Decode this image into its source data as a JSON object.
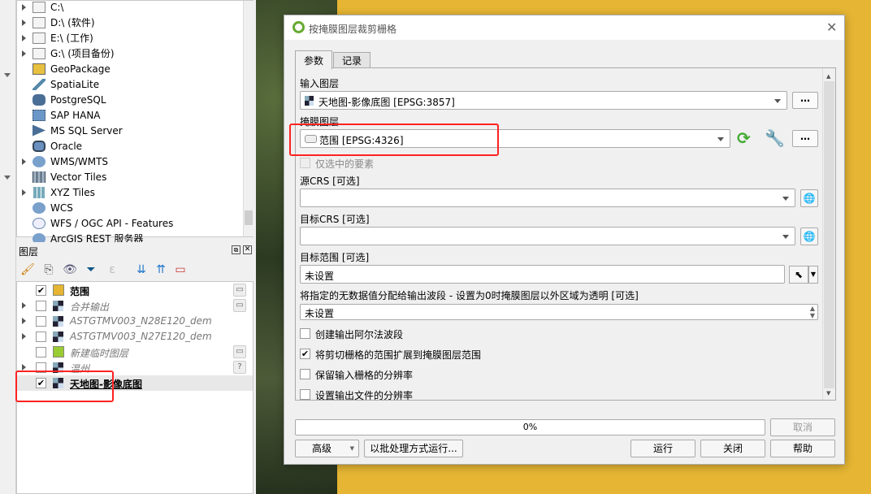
{
  "browser": {
    "items": [
      {
        "label": "C:\\",
        "icon": "folder-icon",
        "expand": true
      },
      {
        "label": "D:\\ (软件)",
        "icon": "folder-icon",
        "expand": true
      },
      {
        "label": "E:\\ (工作)",
        "icon": "folder-icon",
        "expand": true
      },
      {
        "label": "G:\\ (项目备份)",
        "icon": "folder-icon",
        "expand": true
      },
      {
        "label": "GeoPackage",
        "icon": "geopackage-icon",
        "expand": false
      },
      {
        "label": "SpatiaLite",
        "icon": "feather-icon",
        "expand": false
      },
      {
        "label": "PostgreSQL",
        "icon": "elephant-icon",
        "expand": false
      },
      {
        "label": "SAP HANA",
        "icon": "hana-icon",
        "expand": false
      },
      {
        "label": "MS SQL Server",
        "icon": "mssql-icon",
        "expand": false
      },
      {
        "label": "Oracle",
        "icon": "oracle-icon",
        "expand": false
      },
      {
        "label": "WMS/WMTS",
        "icon": "globe-icon",
        "expand": true
      },
      {
        "label": "Vector Tiles",
        "icon": "grid-icon",
        "expand": false
      },
      {
        "label": "XYZ Tiles",
        "icon": "tiles-icon",
        "expand": true
      },
      {
        "label": "WCS",
        "icon": "globe-icon",
        "expand": false
      },
      {
        "label": "WFS / OGC API - Features",
        "icon": "wfs-icon",
        "expand": false
      },
      {
        "label": "ArcGIS REST 服务器",
        "icon": "globe-icon",
        "expand": false
      }
    ]
  },
  "layers": {
    "title": "图层",
    "items": [
      {
        "name": "范围",
        "checked": true,
        "style": "bold",
        "icon": "polygon-icon"
      },
      {
        "name": "合并输出",
        "checked": false,
        "style": "italic",
        "icon": "raster-icon"
      },
      {
        "name": "ASTGTMV003_N28E120_dem",
        "checked": false,
        "style": "italic",
        "icon": "raster-icon"
      },
      {
        "name": "ASTGTMV003_N27E120_dem",
        "checked": false,
        "style": "italic",
        "icon": "raster-icon"
      },
      {
        "name": "新建临时图层",
        "checked": false,
        "style": "italic",
        "icon": "pencil-icon"
      },
      {
        "name": "温州",
        "checked": false,
        "style": "italic",
        "icon": "raster-icon"
      },
      {
        "name": "天地图-影像底图",
        "checked": true,
        "style": "bold-underline",
        "icon": "raster-icon"
      }
    ]
  },
  "dialog": {
    "title": "按掩膜图层裁剪栅格",
    "tabs": [
      "参数",
      "记录"
    ],
    "input_layer_label": "输入图层",
    "input_layer_value": "天地图-影像底图 [EPSG:3857]",
    "mask_layer_label": "掩膜图层",
    "mask_layer_value": "范围 [EPSG:4326]",
    "selected_only_label": "仅选中的要素",
    "source_crs_label": "源CRS [可选]",
    "target_crs_label": "目标CRS [可选]",
    "target_extent_label": "目标范围 [可选]",
    "target_extent_value": "未设置",
    "nodata_label": "将指定的无数据值分配给输出波段 - 设置为0时掩膜图层以外区域为透明 [可选]",
    "nodata_value": "未设置",
    "checkboxes": [
      {
        "label": "创建输出阿尔法波段",
        "checked": false
      },
      {
        "label": "将剪切栅格的范围扩展到掩膜图层范围",
        "checked": true
      },
      {
        "label": "保留输入栅格的分辨率",
        "checked": false
      },
      {
        "label": "设置输出文件的分辨率",
        "checked": false
      }
    ],
    "progress": "0%",
    "ellipsis": "…",
    "buttons": {
      "cancel": "取消",
      "advanced": "高级",
      "batch": "以批处理方式运行...",
      "run": "运行",
      "close": "关闭",
      "help": "帮助"
    }
  },
  "colors": {
    "map_fill": "#e5b533",
    "highlight": "#ff2222"
  }
}
